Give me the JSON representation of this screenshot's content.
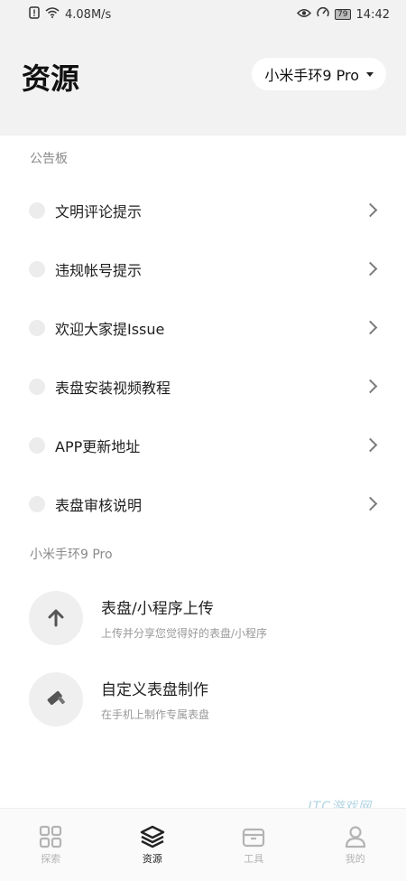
{
  "status_bar": {
    "speed": "4.08M/s",
    "battery": "79",
    "time": "14:42"
  },
  "header": {
    "title": "资源",
    "device": "小米手环9 Pro"
  },
  "bulletin": {
    "label": "公告板",
    "items": [
      {
        "label": "文明评论提示"
      },
      {
        "label": "违规帐号提示"
      },
      {
        "label": "欢迎大家提Issue"
      },
      {
        "label": "表盘安装视频教程"
      },
      {
        "label": "APP更新地址"
      },
      {
        "label": "表盘审核说明"
      }
    ]
  },
  "device_section": {
    "label": "小米手环9 Pro",
    "tools": [
      {
        "title": "表盘/小程序上传",
        "subtitle": "上传并分享您觉得好的表盘/小程序",
        "icon": "upload-arrow-icon"
      },
      {
        "title": "自定义表盘制作",
        "subtitle": "在手机上制作专属表盘",
        "icon": "hammer-icon"
      }
    ]
  },
  "nav": {
    "items": [
      {
        "label": "探索",
        "icon": "grid-icon"
      },
      {
        "label": "资源",
        "icon": "layers-icon",
        "active": true
      },
      {
        "label": "工具",
        "icon": "toolbox-icon"
      },
      {
        "label": "我的",
        "icon": "user-icon"
      }
    ]
  },
  "watermark": "ITC游戏网",
  "colors": {
    "header_bg": "#f2f2f2",
    "text": "#1f1f1f",
    "muted": "#8a8a8a"
  }
}
